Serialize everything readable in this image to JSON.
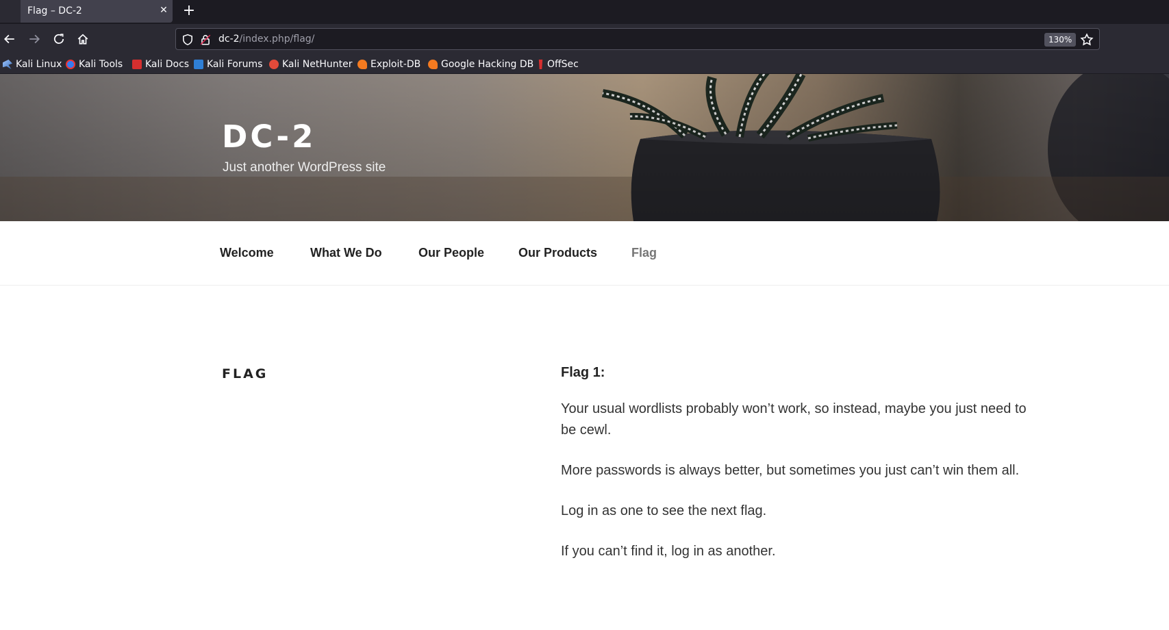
{
  "browser": {
    "tab_title": "Flag – DC-2",
    "url_host": "dc-2",
    "url_path": "/index.php/flag/",
    "zoom": "130%",
    "bookmarks": [
      "Kali Linux",
      "Kali Tools",
      "Kali Docs",
      "Kali Forums",
      "Kali NetHunter",
      "Exploit-DB",
      "Google Hacking DB",
      "OffSec"
    ]
  },
  "site": {
    "title": "DC-2",
    "description": "Just another WordPress site",
    "menu": [
      "Welcome",
      "What We Do",
      "Our People",
      "Our Products",
      "Flag"
    ]
  },
  "page": {
    "title": "FLAG",
    "heading": "Flag 1:",
    "paragraphs": [
      "Your usual wordlists probably won’t work, so instead, maybe you just need to be cewl.",
      "More passwords is always better, but sometimes you just can’t win them all.",
      "Log in as one to see the next flag.",
      "If you can’t find it, log in as another."
    ]
  }
}
